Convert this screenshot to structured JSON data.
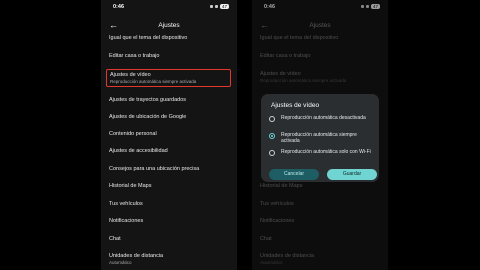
{
  "status": {
    "time": "0:46",
    "battery": "47"
  },
  "header": {
    "title": "Ajustes",
    "back_icon": "arrow-left-icon"
  },
  "settings": {
    "intro": "Igual que el tema del dispositivo",
    "items": [
      {
        "label": "Editar casa o trabajo",
        "sub": ""
      },
      {
        "label": "Ajustes de vídeo",
        "sub": "Reproducción automática siempre activada"
      },
      {
        "label": "Ajustes de trayectos guardados",
        "sub": ""
      },
      {
        "label": "Ajustes de ubicación de Google",
        "sub": ""
      },
      {
        "label": "Contenido personal",
        "sub": ""
      },
      {
        "label": "Ajustes de accesibilidad",
        "sub": ""
      },
      {
        "label": "Consejos para una ubicación precisa",
        "sub": ""
      },
      {
        "label": "Historial de Maps",
        "sub": ""
      },
      {
        "label": "Tus vehículos",
        "sub": ""
      },
      {
        "label": "Notificaciones",
        "sub": ""
      },
      {
        "label": "Chat",
        "sub": ""
      },
      {
        "label": "Unidades de distancia",
        "sub": "Automático"
      }
    ]
  },
  "dialog": {
    "title": "Ajustes de vídeo",
    "options": [
      {
        "label": "Reproducción automática desactivada",
        "selected": false
      },
      {
        "label": "Reproducción automática siempre activada",
        "selected": true
      },
      {
        "label": "Reproducción automática solo con Wi-Fi",
        "selected": false
      }
    ],
    "cancel_label": "Cancelar",
    "save_label": "Guardar"
  },
  "colors": {
    "accent": "#6fd4d2",
    "highlight": "#e0392b",
    "background": "#141414"
  }
}
